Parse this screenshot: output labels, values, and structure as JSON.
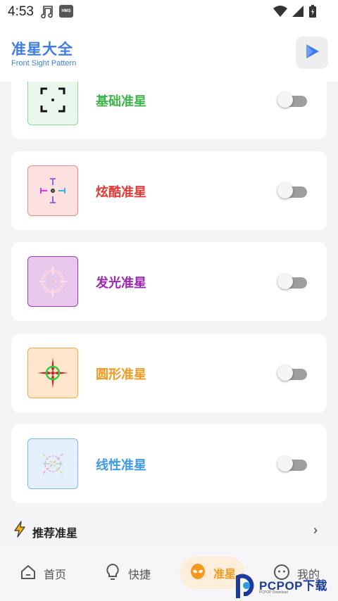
{
  "status_bar": {
    "time": "4:53",
    "hms_badge": "HMS",
    "icons": [
      "music-note-icon",
      "hms-icon",
      "wifi-icon",
      "signal-icon",
      "battery-icon"
    ]
  },
  "header": {
    "title": "准星大全",
    "subtitle": "Front Sight Pattern",
    "action_icon": "play-icon"
  },
  "cards": [
    {
      "label": "基础准星",
      "color": "#3db54a",
      "thumb_bg": "#eaf7ec",
      "thumb_border": "#8fd49a",
      "enabled": false
    },
    {
      "label": "炫酷准星",
      "color": "#e53935",
      "thumb_bg": "#fde0e0",
      "thumb_border": "#ef8a8a",
      "enabled": false
    },
    {
      "label": "发光准星",
      "color": "#9c27b0",
      "thumb_bg": "#e6c9ea",
      "thumb_border": "#a13bb3",
      "enabled": false
    },
    {
      "label": "圆形准星",
      "color": "#f39a1e",
      "thumb_bg": "#fde6cc",
      "thumb_border": "#f0a848",
      "enabled": false
    },
    {
      "label": "线性准星",
      "color": "#3d9be9",
      "thumb_bg": "#e3f0fb",
      "thumb_border": "#7db7ec",
      "enabled": false
    }
  ],
  "recommend": {
    "label": "推荐准星",
    "icon": "lightning-icon",
    "arrow": "›"
  },
  "tabs": [
    {
      "label": "首页",
      "icon": "home-icon"
    },
    {
      "label": "快捷",
      "icon": "lightbulb-icon"
    },
    {
      "label": "准星",
      "icon": "alien-icon",
      "active": true
    },
    {
      "label": "我的",
      "icon": "face-icon"
    }
  ],
  "watermark": {
    "text": "PCPOP下载",
    "sub": "PCPOP Download"
  },
  "colors": {
    "accent": "#3d7cf0",
    "active_tab": "#f39a1e"
  }
}
